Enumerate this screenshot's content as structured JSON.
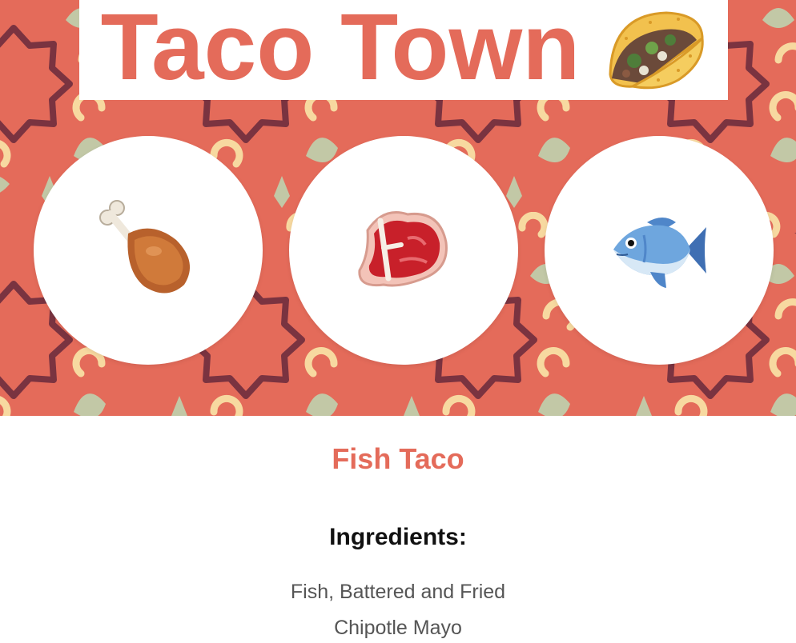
{
  "header": {
    "title": "Taco Town",
    "title_icon": "taco-icon"
  },
  "choices": [
    {
      "id": "chicken",
      "icon": "poultry-leg-icon"
    },
    {
      "id": "beef",
      "icon": "steak-icon"
    },
    {
      "id": "fish",
      "icon": "fish-icon"
    }
  ],
  "selected": {
    "name": "Fish Taco",
    "ingredients_heading": "Ingredients:",
    "ingredients": [
      "Fish, Battered and Fried",
      "Chipotle Mayo"
    ]
  },
  "colors": {
    "accent": "#e46b5a",
    "pattern_background": "#e46b5a",
    "pattern_dark": "#7a3340",
    "pattern_sage": "#c2c8a6",
    "pattern_cream": "#f7d9a0",
    "text_dark": "#111111",
    "text_muted": "#555555"
  }
}
